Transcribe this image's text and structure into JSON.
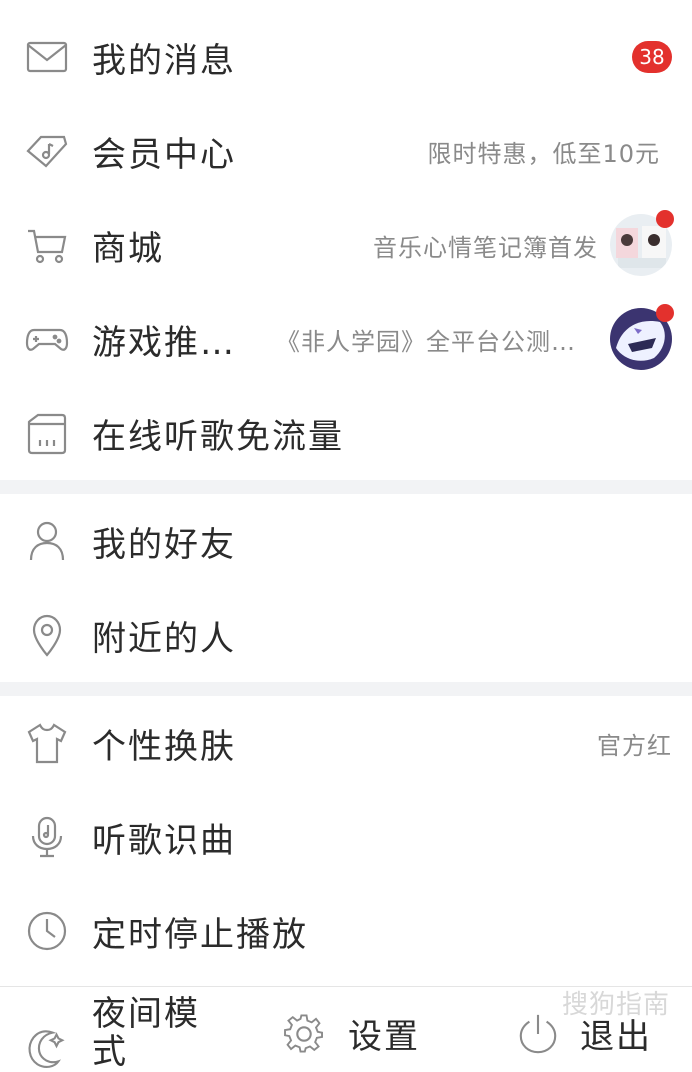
{
  "menu": {
    "messages": {
      "label": "我的消息",
      "badge": "38"
    },
    "vip": {
      "label": "会员中心",
      "promo": "限时特惠，低至10元"
    },
    "mall": {
      "label": "商城",
      "promo": "音乐心情笔记簿首发"
    },
    "games": {
      "label": "游戏推…",
      "promo": "《非人学园》全平台公测…"
    },
    "free_data": {
      "label": "在线听歌免流量"
    },
    "friends": {
      "label": "我的好友"
    },
    "nearby": {
      "label": "附近的人"
    },
    "skin": {
      "label": "个性换肤",
      "value": "官方红"
    },
    "recognize": {
      "label": "听歌识曲"
    },
    "timer": {
      "label": "定时停止播放"
    }
  },
  "bottom_bar": {
    "night_mode": "夜间模式",
    "settings": "设置",
    "logout": "退出"
  },
  "watermark": "搜狗指南",
  "colors": {
    "accent": "#e3312d",
    "icon": "#8a8a8a",
    "separator": "#f2f3f5"
  }
}
